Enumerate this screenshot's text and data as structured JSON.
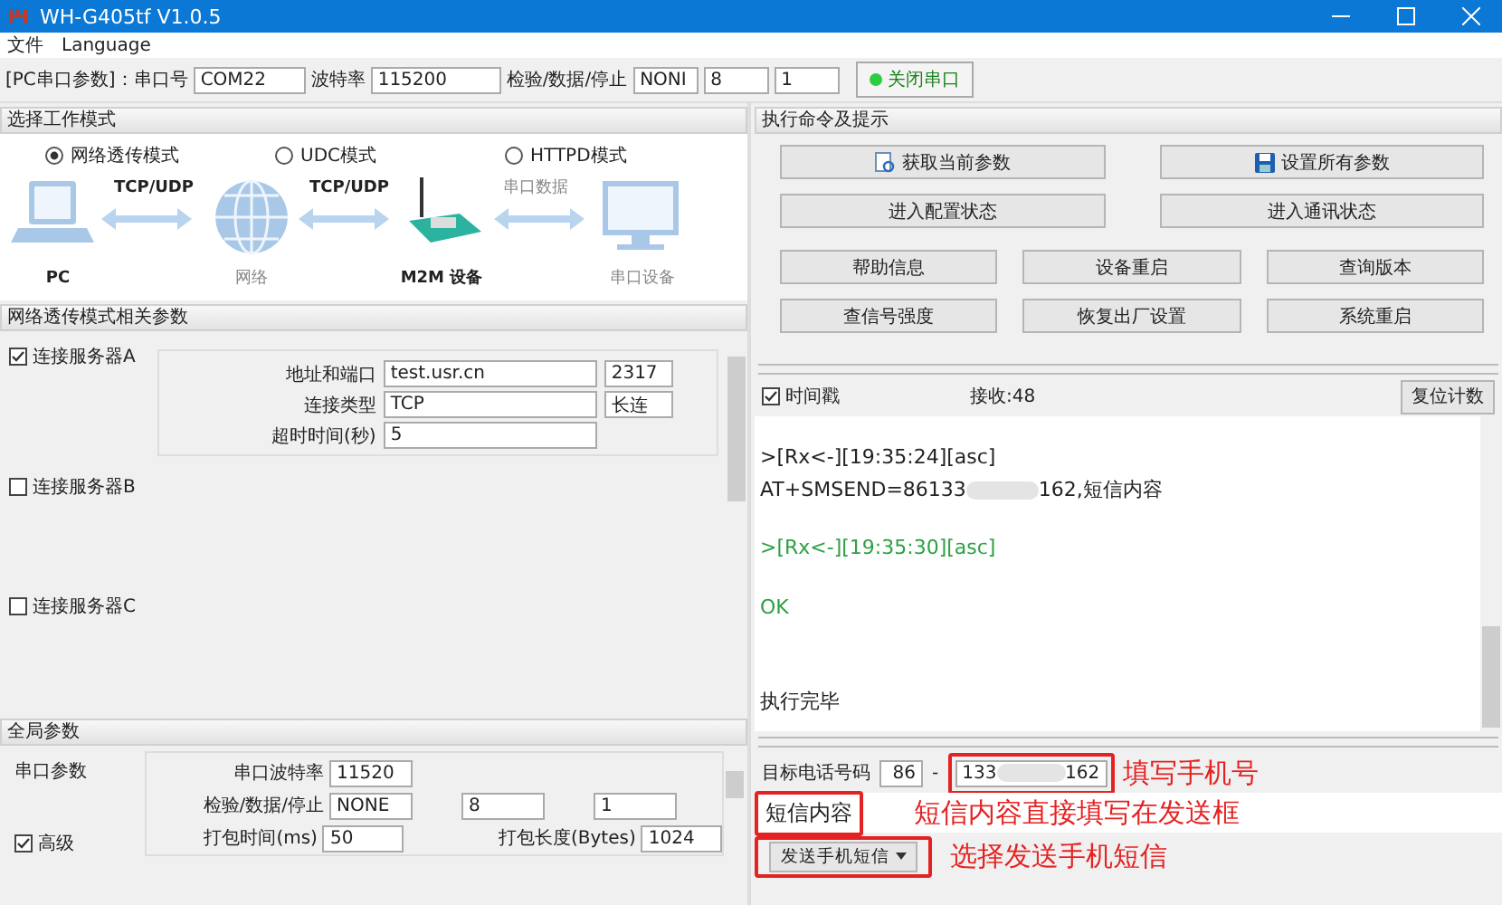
{
  "window": {
    "title": "WH-G405tf V1.0.5"
  },
  "menu": [
    "文件",
    "Language"
  ],
  "serial_bar": {
    "label": "[PC串口参数]：串口号",
    "port": "COM22",
    "baud_label": "波特率",
    "baud": "115200",
    "check_label": "检验/数据/停止",
    "parity": "NONI",
    "data_bits": "8",
    "stop_bits": "1",
    "close_button": "关闭串口"
  },
  "work_mode": {
    "title": "选择工作模式",
    "modes": [
      {
        "label": "网络透传模式",
        "selected": true
      },
      {
        "label": "UDC模式",
        "selected": false
      },
      {
        "label": "HTTPD模式",
        "selected": false
      }
    ],
    "nodes": [
      "PC",
      "网络",
      "M2M 设备",
      "串口设备"
    ],
    "links": [
      "TCP/UDP",
      "TCP/UDP",
      "串口数据"
    ]
  },
  "network_params": {
    "title": "网络透传模式相关参数",
    "servers": [
      {
        "label": "连接服务器A",
        "checked": true
      },
      {
        "label": "连接服务器B",
        "checked": false
      },
      {
        "label": "连接服务器C",
        "checked": false
      }
    ],
    "address_label": "地址和端口",
    "address": "test.usr.cn",
    "port": "2317",
    "type_label": "连接类型",
    "type": "TCP",
    "conn_mode": "长连",
    "timeout_label": "超时时间(秒)",
    "timeout": "5"
  },
  "global_params": {
    "title": "全局参数",
    "serial_label": "串口参数",
    "baud_label": "串口波特率",
    "baud": "11520",
    "check_label": "检验/数据/停止",
    "parity": "NONE",
    "data_bits": "8",
    "stop_bits": "1",
    "pack_time_label": "打包时间(ms)",
    "pack_time": "50",
    "pack_len_label": "打包长度(Bytes)",
    "pack_len": "1024",
    "advanced": {
      "label": "高级",
      "checked": true
    }
  },
  "commands": {
    "title": "执行命令及提示",
    "large_buttons": [
      {
        "label": "获取当前参数",
        "kind": "read"
      },
      {
        "label": "设置所有参数",
        "kind": "save"
      },
      {
        "label": "进入配置状态",
        "kind": "plain"
      },
      {
        "label": "进入通讯状态",
        "kind": "plain"
      }
    ],
    "small_buttons": [
      "帮助信息",
      "设备重启",
      "查询版本",
      "查信号强度",
      "恢复出厂设置",
      "系统重启"
    ]
  },
  "log": {
    "timestamp": {
      "label": "时间戳",
      "checked": true
    },
    "receive": "接收:48",
    "reset_button": "复位计数",
    "lines": [
      {
        "kind": "header",
        "color": "#222222",
        "text": ">[Rx<-][19:35:24][asc]"
      },
      {
        "kind": "masked",
        "color": "#222222",
        "before": "AT+SMSEND=86133",
        "after": "162,短信内容"
      },
      {
        "kind": "header",
        "color": "#2ea043",
        "text": ">[Rx<-][19:35:30][asc]"
      },
      {
        "kind": "reply",
        "color": "#2ea043",
        "text": "OK"
      },
      {
        "kind": "status",
        "color": "#222222",
        "text": "执行完毕"
      }
    ]
  },
  "sms": {
    "phone_label": "目标电话号码",
    "country_code": "86",
    "dash": "-",
    "phone_before": "133",
    "phone_after": "162",
    "content": "短信内容",
    "send_mode_button": "发送手机短信"
  },
  "annotations": [
    "填写手机号",
    "短信内容直接填写在发送框",
    "选择发送手机短信"
  ]
}
